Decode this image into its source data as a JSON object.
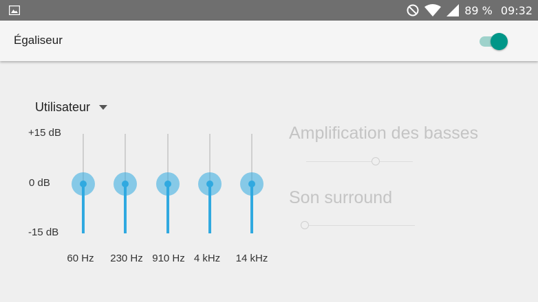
{
  "status_bar": {
    "left_icon": "image-notification-icon",
    "dnd_icon": "do-not-disturb-icon",
    "wifi_icon": "wifi-icon",
    "signal_icon": "cell-signal-icon",
    "battery": "89 %",
    "time": "09:32"
  },
  "toolbar": {
    "title": "Égaliseur",
    "switch_on": true,
    "accent_color": "#009688"
  },
  "preset": {
    "label": "Utilisateur"
  },
  "equalizer": {
    "db_labels": {
      "max": "+15 dB",
      "mid": "0 dB",
      "min": "-15 dB"
    },
    "range_db": [
      -15,
      15
    ],
    "bands": [
      {
        "label": "60 Hz",
        "value_db": 0
      },
      {
        "label": "230 Hz",
        "value_db": 0
      },
      {
        "label": "910 Hz",
        "value_db": 0
      },
      {
        "label": "4 kHz",
        "value_db": 0
      },
      {
        "label": "14 kHz",
        "value_db": 0
      }
    ],
    "band_color": "#30a9e0"
  },
  "effects": {
    "bass_boost": {
      "label": "Amplification des basses",
      "level": 0.65,
      "enabled": false
    },
    "surround": {
      "label": "Son surround",
      "level": 0.0,
      "enabled": false
    }
  }
}
